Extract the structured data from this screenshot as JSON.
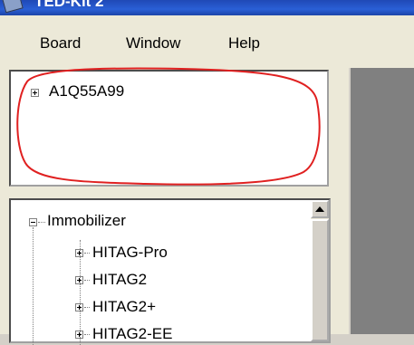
{
  "window": {
    "title": "TED-Kit 2"
  },
  "menu": {
    "items": [
      "Board",
      "Window",
      "Help"
    ]
  },
  "board_tree": {
    "items": [
      {
        "label": "A1Q55A99",
        "expanded": false
      }
    ]
  },
  "function_tree": {
    "root": {
      "label": "Immobilizer",
      "expanded": true
    },
    "children": [
      {
        "label": "HITAG-Pro",
        "expanded": false
      },
      {
        "label": "HITAG2",
        "expanded": false
      },
      {
        "label": "HITAG2+",
        "expanded": false
      },
      {
        "label": "HITAG2-EE",
        "expanded": false
      }
    ]
  },
  "annotation": {
    "color": "#e02020",
    "shape": "ellipse"
  }
}
